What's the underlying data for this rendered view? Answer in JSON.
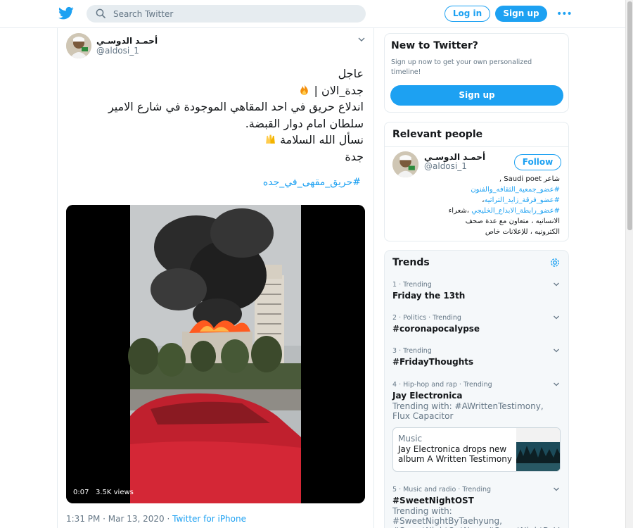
{
  "header": {
    "search_placeholder": "Search Twitter",
    "login_label": "Log in",
    "signup_label": "Sign up",
    "more_glyph": "•••",
    "brand_color": "#1da1f2"
  },
  "tweet": {
    "author_name": "أحمـد الدوسـي",
    "author_handle": "@aldosi_1",
    "lines": [
      "عاجل",
      "جدة_الان |",
      "اندلاع حريق في احد المقاهي الموجودة في شارع الامير",
      "سلطان امام دوار القبضة.",
      "نسأل الله السلامة",
      "جدة"
    ],
    "hashtag": "#حريق_مقهى_في_جده",
    "video_duration": "0:07",
    "video_views": "3.5K views",
    "timestamp": "1:31 PM · Mar 13, 2020 · ",
    "source": "Twitter for iPhone"
  },
  "signup_card": {
    "title": "New to Twitter?",
    "text": "Sign up now to get your own personalized timeline!",
    "button": "Sign up"
  },
  "relevant": {
    "title": "Relevant people",
    "name": "أحمـد الدوسـي",
    "handle": "@aldosi_1",
    "follow": "Follow",
    "bio_line1_text": "شاعر Saudi poet ,",
    "bio_line2_tag": "#عضو_جمعية_الثقافه_والفنون",
    "bio_line3_tag": "#عضو_فرقة_زايد_التراثيه",
    "bio_line3_suffix": "،",
    "bio_line4_tag": "#عضو_رابطة_الابداع_الخليجي",
    "bio_line4_suffix": " ،شعراء",
    "bio_line5": "الانسانيه ، متعاون مع عدة صحف",
    "bio_line6": "الكترونيه ، للإعلانات خاص"
  },
  "trends": {
    "title": "Trends",
    "items": [
      {
        "meta": "1 · Trending",
        "name": "Friday the 13th",
        "with": ""
      },
      {
        "meta": "2 · Politics · Trending",
        "name": "#coronapocalypse",
        "with": ""
      },
      {
        "meta": "3 · Trending",
        "name": "#FridayThoughts",
        "with": ""
      },
      {
        "meta": "4 · Hip-hop and rap · Trending",
        "name": "Jay Electronica",
        "with": "Trending with: #AWrittenTestimony, Flux Capacitor"
      },
      {
        "meta": "5 · Music and radio · Trending",
        "name": "#SweetNightOST",
        "with": "Trending with: #SweetNightByTaehyung, #SweetNightOutNow, #SweetNightByV"
      }
    ],
    "media_card": {
      "kicker": "Music",
      "text": "Jay Electronica drops new album A Written Testimony"
    }
  }
}
